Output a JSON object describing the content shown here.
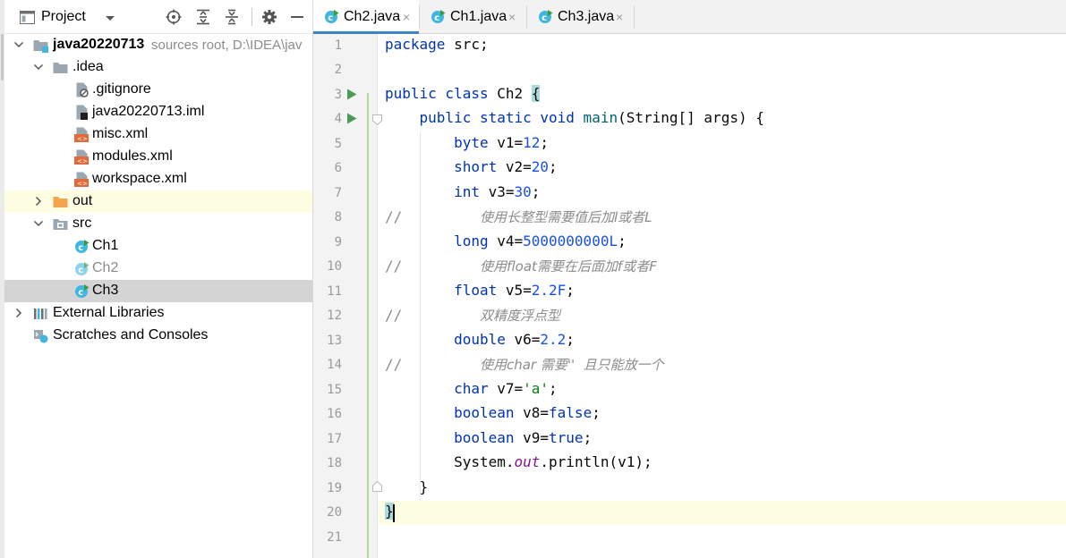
{
  "panel": {
    "title": "Project",
    "tree": [
      {
        "label": "java20220713",
        "extra": "sources root,  D:\\IDEA\\jav",
        "icon": "module-folder-icon"
      },
      {
        "label": ".idea",
        "icon": "folder-icon"
      },
      {
        "label": ".gitignore",
        "icon": "ignored-file-icon"
      },
      {
        "label": "java20220713.iml",
        "icon": "iml-file-icon"
      },
      {
        "label": "misc.xml",
        "icon": "xml-file-icon"
      },
      {
        "label": "modules.xml",
        "icon": "xml-file-icon"
      },
      {
        "label": "workspace.xml",
        "icon": "xml-file-icon"
      },
      {
        "label": "out",
        "icon": "excluded-folder-icon"
      },
      {
        "label": "src",
        "icon": "source-folder-icon"
      },
      {
        "label": "Ch1",
        "icon": "java-class-icon"
      },
      {
        "label": "Ch2",
        "icon": "java-class-icon"
      },
      {
        "label": "Ch3",
        "icon": "java-class-icon"
      },
      {
        "label": "External Libraries",
        "icon": "libraries-icon"
      },
      {
        "label": "Scratches and Consoles",
        "icon": "scratches-icon"
      }
    ]
  },
  "tabs": [
    {
      "label": "Ch2.java",
      "close": "×",
      "active": true
    },
    {
      "label": "Ch1.java",
      "close": "×"
    },
    {
      "label": "Ch3.java",
      "close": "×"
    }
  ],
  "lines": [
    "1",
    "2",
    "3",
    "4",
    "5",
    "6",
    "7",
    "8",
    "9",
    "10",
    "11",
    "12",
    "13",
    "14",
    "15",
    "16",
    "17",
    "18",
    "19",
    "20",
    "21"
  ],
  "code": {
    "l1": {
      "kw": "package",
      "rest": " src;"
    },
    "l3": {
      "kw": "public class",
      "name": " Ch2 ",
      "brace": "{"
    },
    "l4": {
      "kw": "public static void",
      "name": " main",
      "rest": "(String[] args) {"
    },
    "l5": {
      "kw": "byte",
      "var": " v1=",
      "num": "12",
      "end": ";"
    },
    "l6": {
      "kw": "short",
      "var": " v2=",
      "num": "20",
      "end": ";"
    },
    "l7": {
      "kw": "int",
      "var": " v3=",
      "num": "30",
      "end": ";"
    },
    "l8": {
      "slash": "//",
      "text": "使用长整型需要值后加l或者L"
    },
    "l9": {
      "kw": "long",
      "var": " v4=",
      "num": "5000000000L",
      "end": ";"
    },
    "l10": {
      "slash": "//",
      "text": "使用float需要在后面加f或者F"
    },
    "l11": {
      "kw": "float",
      "var": " v5=",
      "num": "2.2F",
      "end": ";"
    },
    "l12": {
      "slash": "//",
      "text": "双精度浮点型"
    },
    "l13": {
      "kw": "double",
      "var": " v6=",
      "num": "2.2",
      "end": ";"
    },
    "l14": {
      "slash": "//",
      "text": "使用char 需要''  且只能放一个"
    },
    "l15": {
      "kw": "char",
      "var": " v7=",
      "str": "'a'",
      "end": ";"
    },
    "l16": {
      "kw": "boolean",
      "var": " v8=",
      "kw2": "false",
      "end": ";"
    },
    "l17": {
      "kw": "boolean",
      "var": " v9=",
      "kw2": "true",
      "end": ";"
    },
    "l18": {
      "pre": "System.",
      "fld": "out",
      "post": ".println(v1);"
    },
    "l19": {
      "text": "}"
    },
    "l20": {
      "brace": "}"
    }
  }
}
